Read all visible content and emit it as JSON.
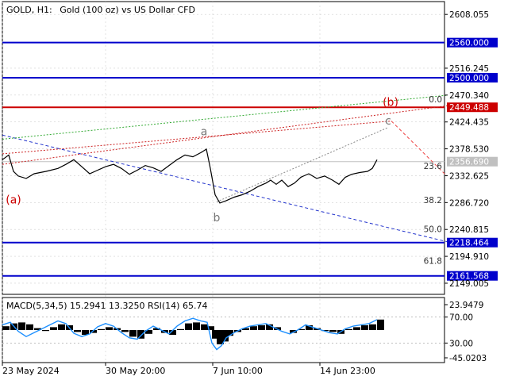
{
  "header": {
    "symbol": "GOLD, H1:",
    "description": "Gold (100 oz) vs US Dollar CFD"
  },
  "chart_data": {
    "type": "line",
    "title": "GOLD, H1:  Gold (100 oz) vs US Dollar CFD",
    "price_axis": {
      "ylim": [
        2130,
        2630
      ],
      "ticks": [
        "2608.055",
        "2516.245",
        "2470.340",
        "2424.435",
        "2378.530",
        "2332.625",
        "2286.720",
        "2240.815",
        "2194.910",
        "2149.005"
      ]
    },
    "time_axis": {
      "tick_labels": [
        "23 May 2024",
        "30 May 20:00",
        "7 Jun 10:00",
        "14 Jun 23:00"
      ],
      "tick_index": [
        0,
        130,
        265,
        400
      ]
    },
    "price_path": [
      [
        0,
        2360
      ],
      [
        8,
        2368
      ],
      [
        14,
        2340
      ],
      [
        20,
        2332
      ],
      [
        30,
        2328
      ],
      [
        40,
        2336
      ],
      [
        55,
        2340
      ],
      [
        70,
        2345
      ],
      [
        80,
        2352
      ],
      [
        90,
        2360
      ],
      [
        100,
        2348
      ],
      [
        110,
        2336
      ],
      [
        120,
        2342
      ],
      [
        130,
        2348
      ],
      [
        140,
        2352
      ],
      [
        150,
        2345
      ],
      [
        160,
        2335
      ],
      [
        170,
        2342
      ],
      [
        180,
        2350
      ],
      [
        190,
        2346
      ],
      [
        200,
        2340
      ],
      [
        210,
        2350
      ],
      [
        220,
        2360
      ],
      [
        230,
        2368
      ],
      [
        240,
        2365
      ],
      [
        250,
        2372
      ],
      [
        257,
        2378
      ],
      [
        262,
        2345
      ],
      [
        268,
        2300
      ],
      [
        274,
        2286
      ],
      [
        282,
        2290
      ],
      [
        292,
        2296
      ],
      [
        302,
        2300
      ],
      [
        312,
        2306
      ],
      [
        322,
        2314
      ],
      [
        332,
        2320
      ],
      [
        338,
        2325
      ],
      [
        345,
        2318
      ],
      [
        352,
        2325
      ],
      [
        360,
        2314
      ],
      [
        368,
        2320
      ],
      [
        376,
        2330
      ],
      [
        386,
        2336
      ],
      [
        396,
        2328
      ],
      [
        406,
        2332
      ],
      [
        416,
        2325
      ],
      [
        424,
        2318
      ],
      [
        432,
        2330
      ],
      [
        440,
        2335
      ],
      [
        450,
        2338
      ],
      [
        460,
        2340
      ],
      [
        466,
        2345
      ],
      [
        472,
        2360
      ]
    ],
    "horizontal_levels": [
      {
        "price": 2560.0,
        "label": "2560.000",
        "color": "#0000cc",
        "style": "solid"
      },
      {
        "price": 2500.0,
        "label": "2500.000",
        "color": "#0000cc",
        "style": "solid"
      },
      {
        "price": 2449.488,
        "label": "2449.488",
        "color": "#cc0000",
        "style": "solid"
      },
      {
        "price": 2356.69,
        "label": "2356.690",
        "color": "#c0c0c0",
        "style": "solid"
      },
      {
        "price": 2218.464,
        "label": "2218.464",
        "color": "#0000cc",
        "style": "solid"
      },
      {
        "price": 2161.568,
        "label": "2161.568",
        "color": "#0000cc",
        "style": "solid"
      }
    ],
    "fib_levels": [
      {
        "ratio": "0.0",
        "price": 2454
      },
      {
        "ratio": "23.6",
        "price": 2340
      },
      {
        "ratio": "38.2",
        "price": 2282
      },
      {
        "ratio": "50.0",
        "price": 2232
      },
      {
        "ratio": "61.8",
        "price": 2178
      }
    ],
    "trend_lines": [
      {
        "from": [
          0,
          2402
        ],
        "to": [
          560,
          2220
        ],
        "color": "#2233cc",
        "style": "dashed"
      },
      {
        "from": [
          0,
          2395
        ],
        "to": [
          560,
          2470
        ],
        "color": "#33aa33",
        "style": "dotted"
      },
      {
        "from": [
          0,
          2352
        ],
        "to": [
          560,
          2452
        ],
        "color": "#cc2222",
        "style": "dotted"
      },
      {
        "from": [
          270,
          2288
        ],
        "to": [
          486,
          2415
        ],
        "color": "#888888",
        "style": "dotted"
      },
      {
        "from": [
          0,
          2370
        ],
        "to": [
          490,
          2426
        ],
        "color": "#cc2222",
        "style": "dotted"
      },
      {
        "from": [
          490,
          2426
        ],
        "to": [
          560,
          2332
        ],
        "color": "#ee4444",
        "style": "dashed"
      }
    ],
    "wave_labels": [
      {
        "text": "(a)",
        "at": [
          14,
          2285
        ],
        "color": "#cc0000"
      },
      {
        "text": "a",
        "at": [
          254,
          2402
        ],
        "color": "#777777"
      },
      {
        "text": "b",
        "at": [
          270,
          2255
        ],
        "color": "#777777"
      },
      {
        "text": "(b)",
        "at": [
          489,
          2452
        ],
        "color": "#cc0000"
      },
      {
        "text": "c",
        "at": [
          486,
          2420
        ],
        "color": "#777777"
      }
    ],
    "indicator": {
      "label": "MACD(5,34,5) 15.2941 13.3250 RSI(14) 65.74",
      "ticks": [
        "23.9479",
        "70.00",
        "30.00",
        "-45.0203"
      ],
      "rsi_levels": [
        70,
        30
      ],
      "macd_histogram": [
        [
          0,
          8
        ],
        [
          10,
          14
        ],
        [
          20,
          16
        ],
        [
          30,
          12
        ],
        [
          40,
          4
        ],
        [
          50,
          -2
        ],
        [
          60,
          6
        ],
        [
          70,
          12
        ],
        [
          80,
          10
        ],
        [
          90,
          -4
        ],
        [
          100,
          -10
        ],
        [
          110,
          -6
        ],
        [
          120,
          2
        ],
        [
          130,
          6
        ],
        [
          140,
          4
        ],
        [
          150,
          -4
        ],
        [
          160,
          -14
        ],
        [
          170,
          -18
        ],
        [
          180,
          -8
        ],
        [
          190,
          4
        ],
        [
          200,
          -6
        ],
        [
          210,
          -10
        ],
        [
          220,
          2
        ],
        [
          230,
          14
        ],
        [
          240,
          16
        ],
        [
          250,
          12
        ],
        [
          258,
          8
        ],
        [
          264,
          -18
        ],
        [
          270,
          -30
        ],
        [
          276,
          -24
        ],
        [
          282,
          -12
        ],
        [
          292,
          -4
        ],
        [
          302,
          4
        ],
        [
          312,
          8
        ],
        [
          322,
          10
        ],
        [
          332,
          12
        ],
        [
          342,
          6
        ],
        [
          352,
          0
        ],
        [
          362,
          -6
        ],
        [
          372,
          2
        ],
        [
          382,
          10
        ],
        [
          392,
          4
        ],
        [
          402,
          -2
        ],
        [
          412,
          -4
        ],
        [
          422,
          -8
        ],
        [
          432,
          2
        ],
        [
          442,
          6
        ],
        [
          452,
          10
        ],
        [
          462,
          12
        ],
        [
          472,
          22
        ]
      ],
      "rsi": [
        [
          0,
          58
        ],
        [
          10,
          62
        ],
        [
          20,
          48
        ],
        [
          30,
          40
        ],
        [
          40,
          46
        ],
        [
          50,
          52
        ],
        [
          60,
          58
        ],
        [
          70,
          64
        ],
        [
          80,
          60
        ],
        [
          90,
          45
        ],
        [
          100,
          40
        ],
        [
          110,
          44
        ],
        [
          120,
          55
        ],
        [
          130,
          60
        ],
        [
          140,
          56
        ],
        [
          150,
          46
        ],
        [
          160,
          38
        ],
        [
          170,
          36
        ],
        [
          180,
          48
        ],
        [
          190,
          56
        ],
        [
          200,
          50
        ],
        [
          210,
          44
        ],
        [
          220,
          56
        ],
        [
          230,
          64
        ],
        [
          240,
          68
        ],
        [
          250,
          64
        ],
        [
          258,
          62
        ],
        [
          264,
          30
        ],
        [
          270,
          20
        ],
        [
          276,
          26
        ],
        [
          282,
          38
        ],
        [
          292,
          46
        ],
        [
          302,
          52
        ],
        [
          312,
          56
        ],
        [
          322,
          58
        ],
        [
          332,
          60
        ],
        [
          342,
          54
        ],
        [
          352,
          48
        ],
        [
          362,
          44
        ],
        [
          372,
          50
        ],
        [
          382,
          58
        ],
        [
          392,
          54
        ],
        [
          402,
          50
        ],
        [
          412,
          46
        ],
        [
          422,
          44
        ],
        [
          432,
          52
        ],
        [
          442,
          56
        ],
        [
          452,
          58
        ],
        [
          462,
          60
        ],
        [
          472,
          66
        ]
      ]
    }
  },
  "colors": {
    "price_line": "#000000",
    "grid": "#d0d0d0",
    "axis_text": "#000000",
    "blue_level": "#0000cc",
    "red_level": "#cc0000",
    "macd_fill": "#000000",
    "rsi_line": "#1e90ff"
  }
}
